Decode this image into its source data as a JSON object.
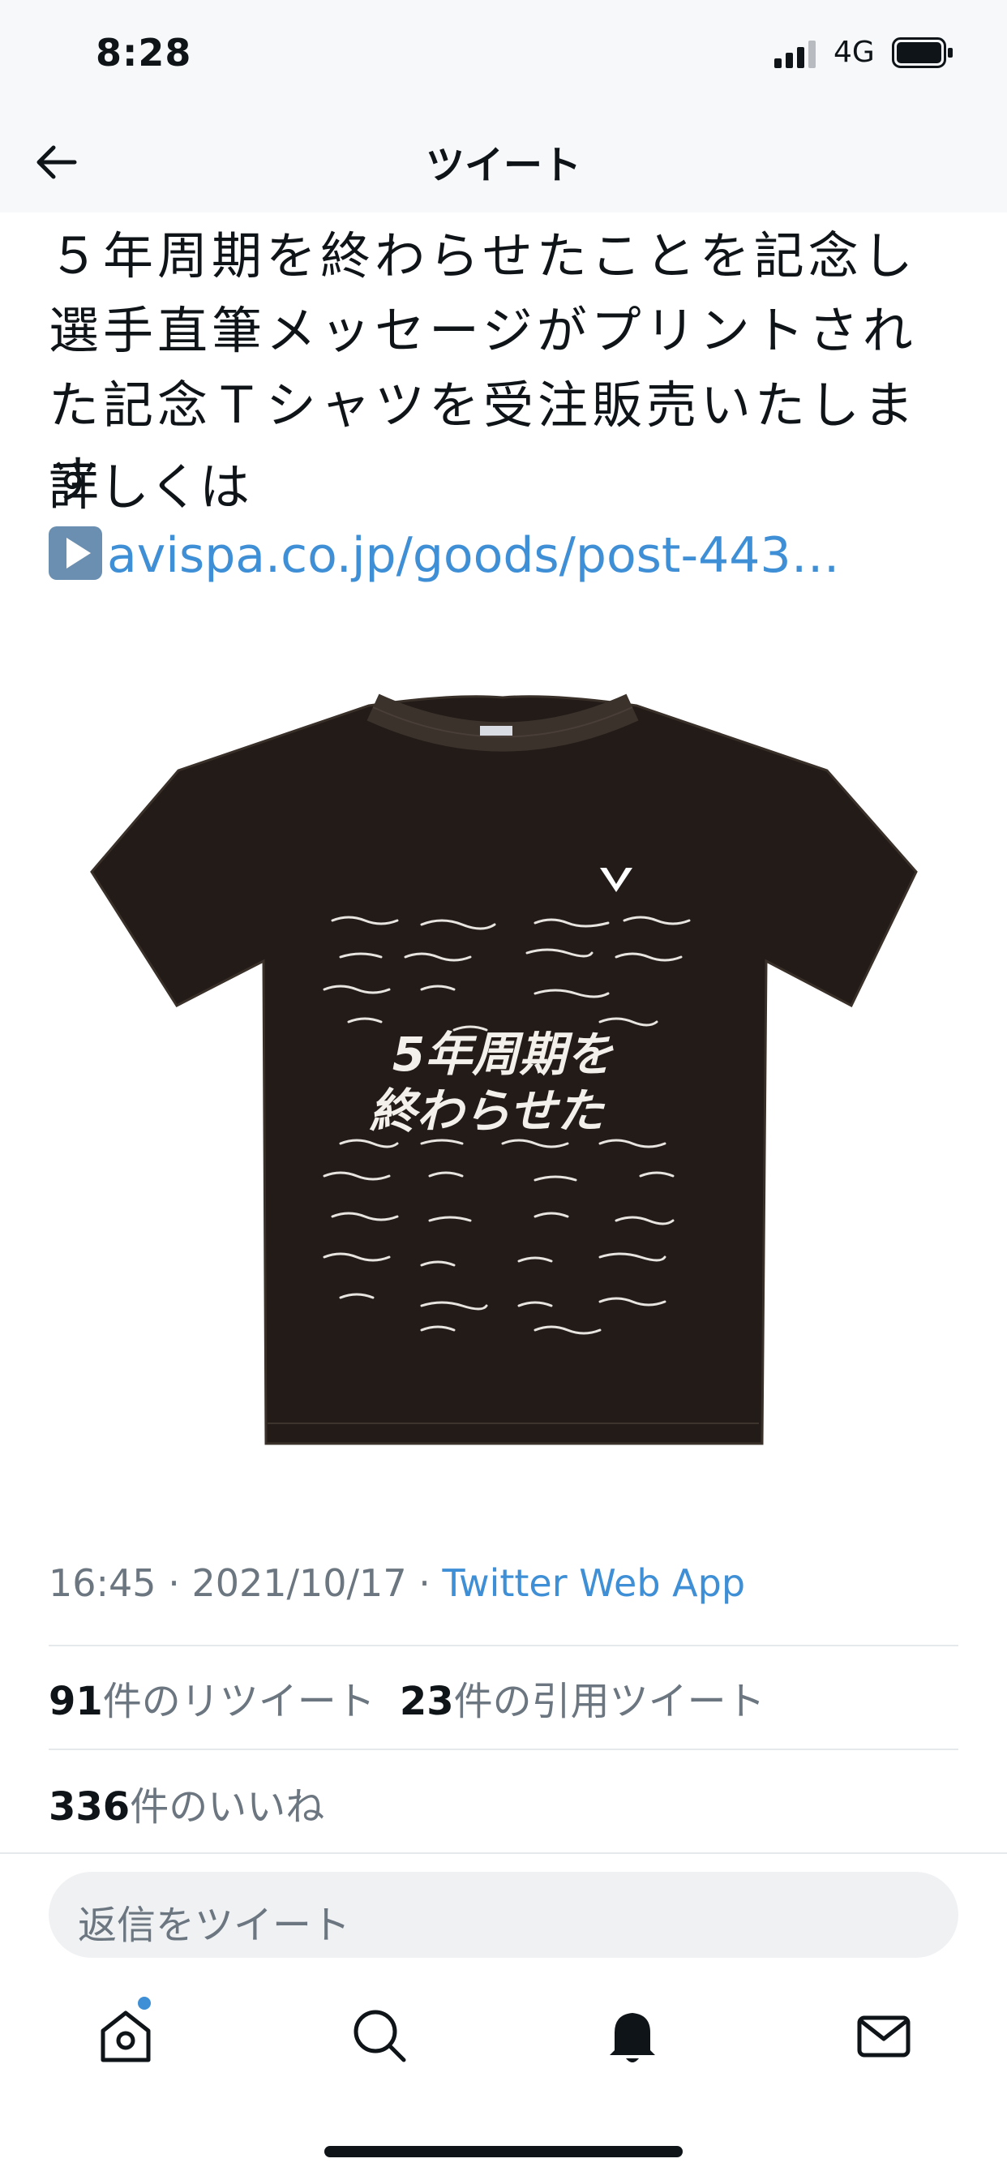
{
  "status": {
    "time": "8:28",
    "network": "4G",
    "icons": [
      "signal-icon",
      "battery-icon"
    ]
  },
  "nav": {
    "title": "ツイート",
    "back_icon": "back-arrow-icon"
  },
  "tweet": {
    "text": "５年周期を終わらせたことを記念し選手直筆メッセージがプリントされた記念Ｔシャツを受注販売いたします",
    "detail_label": "詳しくは",
    "link_icon": "play-button-icon",
    "link_text": "avispa.co.jp/goods/post-443…",
    "media": {
      "shirt_headline_line1": "5年周期を",
      "shirt_headline_line2": "終わらせた"
    },
    "meta": {
      "time": "16:45",
      "sep1": " · ",
      "date": "2021/10/17",
      "sep2": " · ",
      "source": "Twitter Web App"
    },
    "stats": {
      "retweets_count": "91",
      "retweets_label": "件のリツイート",
      "quotes_count": "23",
      "quotes_label": "件の引用ツイート",
      "likes_count": "336",
      "likes_label": "件のいいね"
    }
  },
  "reply": {
    "placeholder": "返信をツイート"
  },
  "tabbar": {
    "icons": [
      "home-icon",
      "search-icon",
      "notifications-icon",
      "messages-icon"
    ]
  },
  "colors": {
    "link": "#3f8fd6",
    "shirt": "#231b17",
    "muted": "#6b7680"
  }
}
